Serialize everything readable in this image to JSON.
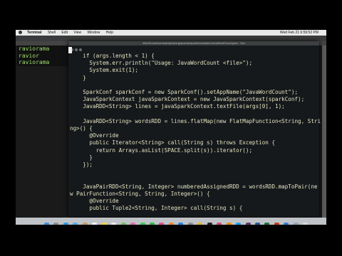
{
  "menubar": {
    "app": "Terminal",
    "items": [
      "Shell",
      "Edit",
      "View",
      "Window",
      "Help"
    ],
    "clock": "Wed Feb 21 6:59:52 PM"
  },
  "background_terminal": {
    "lines": [
      "raviorama",
      "ravior",
      "raviorama"
    ]
  },
  "editor": {
    "title": "WordCount/src/main/java/org/apache/spark/examples/JavaWordCount.java - Vim",
    "code": [
      "    if (args.length < 1) {",
      "      System.err.println(\"Usage: JavaWordCount <file>\");",
      "      System.exit(1);",
      "    }",
      "",
      "    SparkConf sparkConf = new SparkConf().setAppName(\"JavaWordCount\");",
      "    JavaSparkContext javaSparkContext = new JavaSparkContext(sparkConf);",
      "    JavaRDD<String> lines = javaSparkContext.textFile(args[0], 1);",
      "",
      "    JavaRDD<String> wordsRDD = lines.flatMap(new FlatMapFunction<String, Stri",
      "ng>() {",
      "      @Override",
      "      public Iterator<String> call(String s) throws Exception {",
      "        return Arrays.asList(SPACE.split(s)).iterator();",
      "      }",
      "    });",
      "",
      "",
      "    JavaPairRDD<String, Integer> numberedAssignedRDD = wordsRDD.mapToPair(ne",
      "w PairFunction<String, String, Integer>() {",
      "      @Override",
      "      public Tuple2<String, Integer> call(String s) {"
    ]
  },
  "colors": {
    "editor_bg": "#15191c",
    "code_text": "#e6e2c0",
    "prompt_green": "#9fe06f"
  }
}
